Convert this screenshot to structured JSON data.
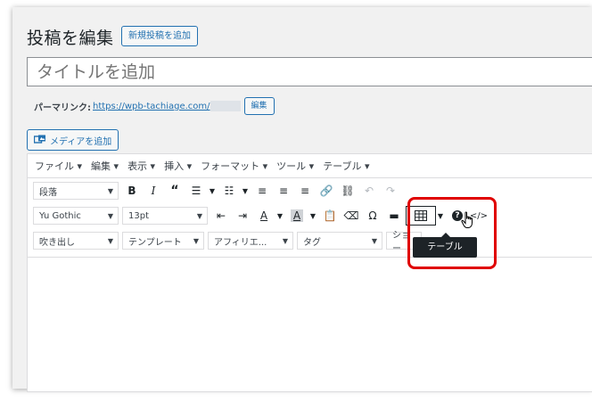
{
  "page": {
    "title": "投稿を編集",
    "add_new_label": "新規投稿を追加"
  },
  "post": {
    "title_placeholder": "タイトルを追加",
    "permalink_label": "パーマリンク:",
    "permalink_url": "https://wpb-tachiage.com/",
    "permalink_edit_label": "編集"
  },
  "media": {
    "add_media_label": "メディアを追加"
  },
  "menubar": {
    "items": [
      "ファイル ▾",
      "編集 ▾",
      "表示 ▾",
      "挿入 ▾",
      "フォーマット ▾",
      "ツール ▾",
      "テーブル ▾"
    ]
  },
  "toolbar1": {
    "format_select": "段落",
    "icons": [
      "bold-icon",
      "italic-icon",
      "blockquote-icon",
      "bullet-list-icon",
      "numbered-list-icon",
      "align-left-icon",
      "align-center-icon",
      "align-right-icon",
      "link-icon",
      "unlink-icon",
      "undo-icon",
      "redo-icon"
    ]
  },
  "toolbar2": {
    "font_family_select": "Yu Gothic",
    "font_size_select": "13pt",
    "icons": [
      "outdent-icon",
      "indent-icon",
      "text-color-icon",
      "background-color-icon",
      "paste-as-text-icon",
      "clear-formatting-icon",
      "special-character-icon",
      "horizontal-line-icon",
      "table-icon",
      "help-icon",
      "code-icon"
    ]
  },
  "toolbar3": {
    "balloon_select": "吹き出し",
    "template_select": "テンプレート",
    "affiliate_select": "アフィリエ...",
    "tag_select": "タグ",
    "shortcode_select_partial": "ショー"
  },
  "tooltip": {
    "text": "テーブル"
  },
  "colors": {
    "accent": "#2271b1",
    "highlight": "#e00000",
    "tooltip_bg": "#1d2327"
  }
}
